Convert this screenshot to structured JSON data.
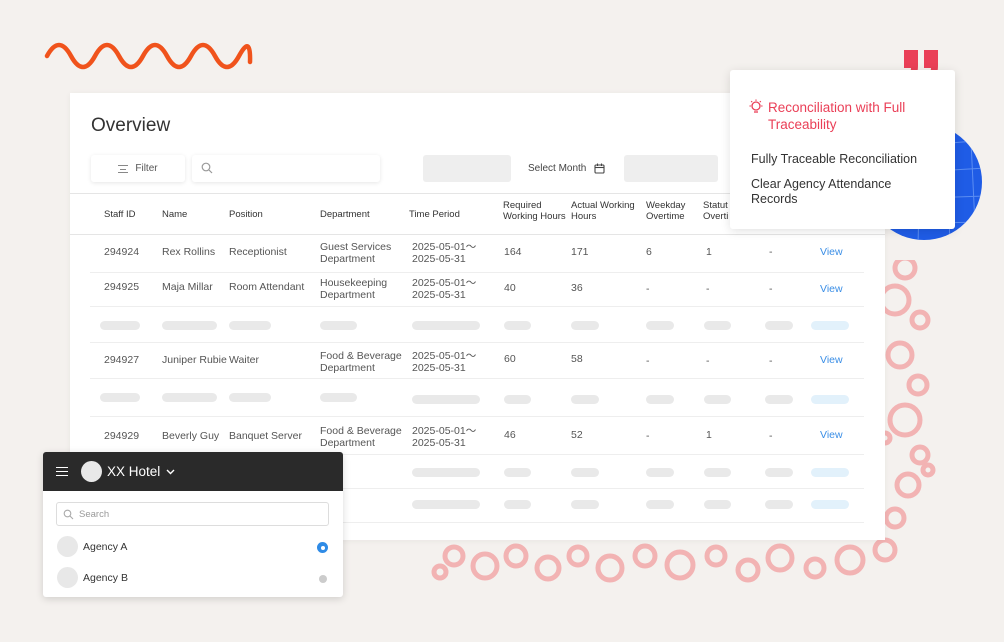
{
  "overview": {
    "title": "Overview",
    "filter_label": "Filter",
    "search_placeholder": "",
    "month_label": "Select Month",
    "columns": [
      "Staff ID",
      "Name",
      "Position",
      "Department",
      "Time Period",
      "Required Working Hours",
      "Actual Working Hours",
      "Weekday Overtime",
      "Statut Overti"
    ],
    "rows": [
      {
        "id": "294924",
        "name": "Rex Rollins",
        "position": "Receptionist",
        "department": "Guest Services Department",
        "period": "2025-05-01～ 2025-05-31",
        "required": "164",
        "actual": "171",
        "weekday_ot": "6",
        "statutory_ot": "1",
        "other": "-",
        "action": "View"
      },
      {
        "id": "294925",
        "name": "Maja Millar",
        "position": "Room Attendant",
        "department": "Housekeeping Department",
        "period": "2025-05-01～ 2025-05-31",
        "required": "40",
        "actual": "36",
        "weekday_ot": "-",
        "statutory_ot": "-",
        "other": "-",
        "action": "View"
      },
      {
        "id": "294927",
        "name": "Juniper Rubie",
        "position": "Waiter",
        "department": "Food & Beverage Department",
        "period": "2025-05-01～ 2025-05-31",
        "required": "60",
        "actual": "58",
        "weekday_ot": "-",
        "statutory_ot": "-",
        "other": "-",
        "action": "View"
      },
      {
        "id": "294929",
        "name": "Beverly Guy",
        "position": "Banquet Server",
        "department": "Food & Beverage Department",
        "period": "2025-05-01～ 2025-05-31",
        "required": "46",
        "actual": "52",
        "weekday_ot": "-",
        "statutory_ot": "1",
        "other": "-",
        "action": "View"
      }
    ]
  },
  "popup": {
    "title": "Reconciliation with Full Traceability",
    "line1": "Fully Traceable Reconciliation",
    "line2": "Clear Agency Attendance Records"
  },
  "agency_panel": {
    "hotel": "XX Hotel",
    "search_placeholder": "Search",
    "agencies": [
      {
        "label": "Agency A",
        "selected": true
      },
      {
        "label": "Agency B",
        "selected": false
      }
    ]
  },
  "colors": {
    "accent_red": "#ea3f57",
    "squiggle_orange": "#f0531c",
    "globe_blue": "#1f5ce6",
    "link_blue": "#3a8ee6",
    "bubble_pink": "#f2b3b3"
  }
}
